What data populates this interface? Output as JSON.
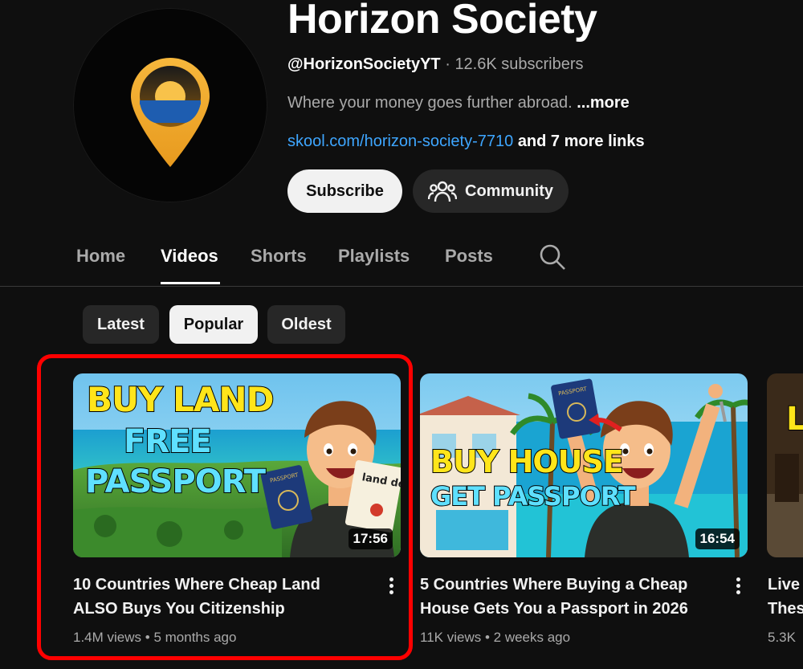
{
  "channel": {
    "name": "Horizon Society",
    "handle": "@HorizonSocietyYT",
    "separator": "·",
    "subscribers": "12.6K subscribers",
    "description": "Where your money goes further abroad.",
    "description_more": "...more",
    "link": "skool.com/horizon-society-7710",
    "more_links": "and 7 more links",
    "avatar_icon": "location-pin-sunset-icon"
  },
  "buttons": {
    "subscribe": "Subscribe",
    "community": "Community",
    "community_icon": "people-icon"
  },
  "tabs": [
    {
      "label": "Home"
    },
    {
      "label": "Videos",
      "active": true
    },
    {
      "label": "Shorts"
    },
    {
      "label": "Playlists"
    },
    {
      "label": "Posts"
    }
  ],
  "search_icon": "search-icon",
  "chips": [
    {
      "label": "Latest"
    },
    {
      "label": "Popular",
      "active": true
    },
    {
      "label": "Oldest"
    }
  ],
  "videos": [
    {
      "title": "10 Countries Where Cheap Land ALSO Buys You Citizenship",
      "views": "1.4M views",
      "sep": "•",
      "age": "5 months ago",
      "duration": "17:56",
      "thumb_text": [
        "BUY LAND",
        "FREE",
        "PASSPORT"
      ],
      "thumb_props": [
        "PASSPORT",
        "land deed"
      ]
    },
    {
      "title": "5 Countries Where Buying a Cheap House Gets You a Passport in 2026",
      "views": "11K views",
      "sep": "•",
      "age": "2 weeks ago",
      "duration": "16:54",
      "thumb_text": [
        "BUY HOUSE",
        "GET PASSPORT"
      ],
      "thumb_props": [
        "PASSPORT"
      ]
    },
    {
      "title_visible": "Live These",
      "meta_visible": "5.3K",
      "thumb_text_visible": "L"
    }
  ],
  "colors": {
    "background": "#0f0f0f",
    "link": "#3ea6ff",
    "highlight": "#ff0000",
    "chip": "#272727"
  }
}
